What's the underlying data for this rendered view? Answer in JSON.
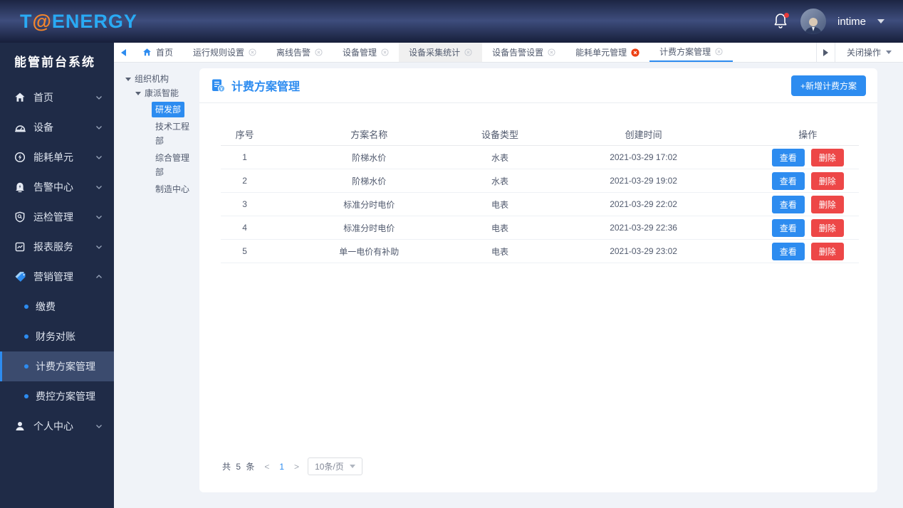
{
  "colors": {
    "primary": "#2d8cf0",
    "danger": "#ed4747",
    "topbar_logo": "#29aaf4",
    "logo_at": "#f5862b",
    "sidebar_bg": "#1f2b47"
  },
  "topbar": {
    "logo_t": "T",
    "logo_at": "@",
    "logo_rest": "ENERGY",
    "user_name": "intime"
  },
  "sidebar": {
    "title": "能管前台系统",
    "items": [
      {
        "label": "首页",
        "icon": "home-icon"
      },
      {
        "label": "设备",
        "icon": "device-icon"
      },
      {
        "label": "能耗单元",
        "icon": "energy-unit-icon"
      },
      {
        "label": "告警中心",
        "icon": "alarm-center-icon"
      },
      {
        "label": "运检管理",
        "icon": "inspection-icon"
      },
      {
        "label": "报表服务",
        "icon": "report-icon"
      },
      {
        "label": "营销管理",
        "icon": "marketing-icon",
        "expanded": true
      }
    ],
    "submenu": {
      "items": [
        {
          "label": "缴费"
        },
        {
          "label": "财务对账"
        },
        {
          "label": "计费方案管理",
          "selected": true
        },
        {
          "label": "费控方案管理"
        }
      ]
    },
    "bottom_item": {
      "label": "个人中心",
      "icon": "user-icon"
    }
  },
  "tabbar": {
    "tabs": [
      {
        "label": "首页",
        "closable": false,
        "home": true
      },
      {
        "label": "运行规则设置"
      },
      {
        "label": "离线告警"
      },
      {
        "label": "设备管理"
      },
      {
        "label": "设备采集统计",
        "grey": true
      },
      {
        "label": "设备告警设置"
      },
      {
        "label": "能耗单元管理",
        "close_style": "red"
      },
      {
        "label": "计费方案管理",
        "active": true
      }
    ],
    "close_ops_label": "关闭操作"
  },
  "tree": {
    "root": "组织机构",
    "company": "康派智能",
    "departments": [
      "研发部",
      "技术工程部",
      "综合管理部",
      "制造中心"
    ],
    "selected": "研发部"
  },
  "main": {
    "title": "计费方案管理",
    "add_button": "+新增计费方案",
    "table": {
      "headers": [
        "序号",
        "方案名称",
        "设备类型",
        "创建时间",
        "操作"
      ],
      "rows": [
        {
          "no": "1",
          "name": "阶梯水价",
          "type": "水表",
          "time": "2021-03-29  17:02"
        },
        {
          "no": "2",
          "name": "阶梯水价",
          "type": "水表",
          "time": "2021-03-29  19:02"
        },
        {
          "no": "3",
          "name": "标准分时电价",
          "type": "电表",
          "time": "2021-03-29  22:02"
        },
        {
          "no": "4",
          "name": "标准分时电价",
          "type": "电表",
          "time": "2021-03-29  22:36"
        },
        {
          "no": "5",
          "name": "单一电价有补助",
          "type": "电表",
          "time": "2021-03-29  23:02"
        }
      ],
      "view_label": "查看",
      "delete_label": "删除"
    },
    "pagination": {
      "total": "共 5 条",
      "prev": "<",
      "current_page": "1",
      "next": ">",
      "page_size": "10条/页"
    }
  }
}
